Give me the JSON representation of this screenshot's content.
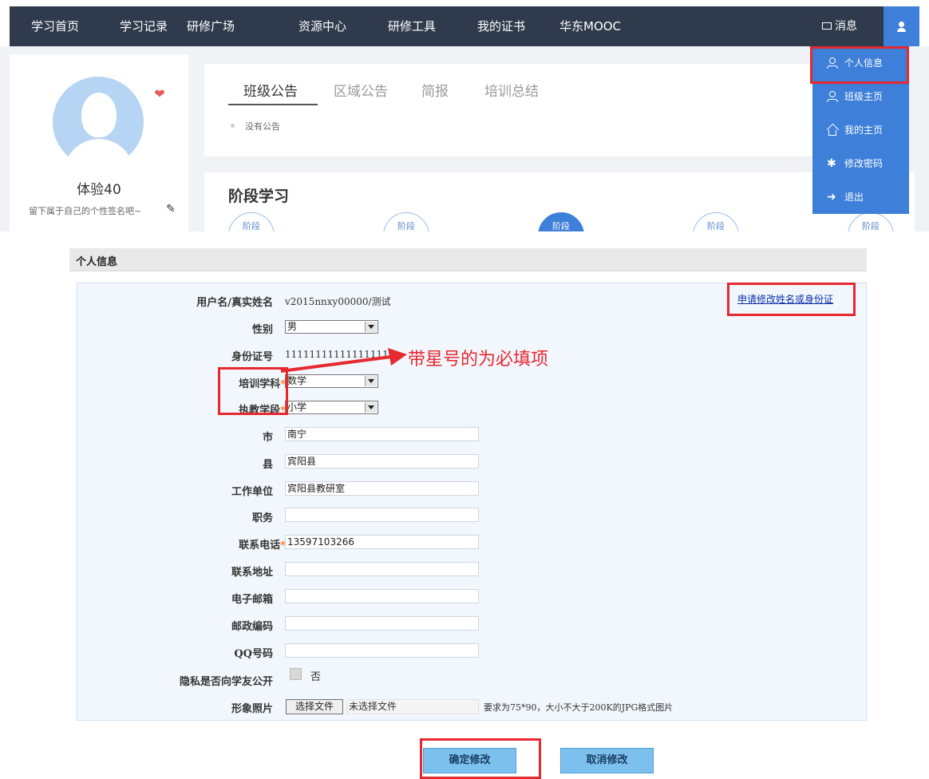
{
  "nav": {
    "items": [
      "学习首页",
      "学习记录",
      "研修广场",
      "资源中心",
      "研修工具",
      "我的证书",
      "华东MOOC"
    ],
    "messages": "消息"
  },
  "dropdown": {
    "items": [
      {
        "label": "个人信息",
        "icon": "user-icon"
      },
      {
        "label": "班级主页",
        "icon": "user-icon"
      },
      {
        "label": "我的主页",
        "icon": "home-icon"
      },
      {
        "label": "修改密码",
        "icon": "gear-icon"
      },
      {
        "label": "退出",
        "icon": "exit-icon"
      }
    ]
  },
  "profile": {
    "name": "体验40",
    "signature": "留下属于自己的个性签名吧~"
  },
  "notice": {
    "tabs": [
      "班级公告",
      "区域公告",
      "简报",
      "培训总结"
    ],
    "active_tab": 0,
    "empty_text": "没有公告"
  },
  "stage": {
    "title": "阶段学习",
    "circle_label": "阶段",
    "active_circle": 2
  },
  "form": {
    "section_title": "个人信息",
    "apply_link": "申请修改姓名或身份证",
    "annotation": "带星号的为必填项",
    "fields": {
      "username_label": "用户名/真实姓名",
      "username_value": "v2015nnxy00000/测试",
      "gender_label": "性别",
      "gender_value": "男",
      "id_label": "身份证号",
      "id_value": "11111111111111111",
      "subject_label": "培训学科",
      "subject_value": "数学",
      "stage_label": "执教学段",
      "stage_value": "小学",
      "city_label": "市",
      "city_value": "南宁",
      "county_label": "县",
      "county_value": "宾阳县",
      "org_label": "工作单位",
      "org_value": "宾阳县教研室",
      "duty_label": "职务",
      "duty_value": "",
      "phone_label": "联系电话",
      "phone_value": "13597103266",
      "address_label": "联系地址",
      "address_value": "",
      "email_label": "电子邮箱",
      "email_value": "",
      "postcode_label": "邮政编码",
      "postcode_value": "",
      "qq_label": "QQ号码",
      "qq_value": "",
      "privacy_label": "隐私是否向学友公开",
      "privacy_option": "否",
      "photo_label": "形象照片",
      "photo_button": "选择文件",
      "photo_none": "未选择文件",
      "photo_hint": "要求为75*90，大小不大于200K的JPG格式图片"
    },
    "required_mark": "*",
    "confirm": "确定修改",
    "cancel": "取消修改"
  },
  "colors": {
    "nav_bg": "#2f3a4c",
    "accent_blue": "#3d7fd9",
    "highlight_red": "#e6282f",
    "required_orange": "#ff7a1a",
    "button_blue": "#7cc1ee"
  }
}
